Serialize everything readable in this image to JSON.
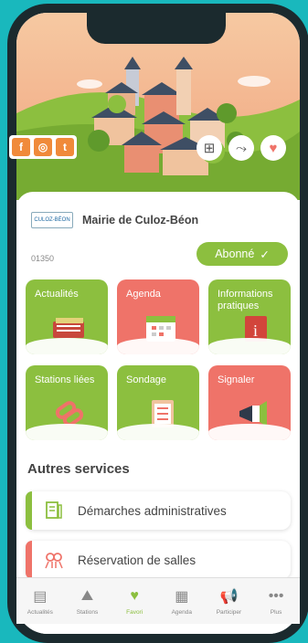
{
  "mairie": {
    "name": "Mairie de Culoz-Béon",
    "logo_text": "CULOZ-BÉON",
    "postal_code": "01350"
  },
  "subscribe_label": "Abonné",
  "social": {
    "facebook": "f",
    "instagram": "◎",
    "twitter": "t"
  },
  "tiles": [
    {
      "label": "Actualités",
      "color": "#8cbf3f"
    },
    {
      "label": "Agenda",
      "color": "#ef7369"
    },
    {
      "label": "Informations pratiques",
      "color": "#8cbf3f"
    },
    {
      "label": "Stations liées",
      "color": "#8cbf3f"
    },
    {
      "label": "Sondage",
      "color": "#8cbf3f"
    },
    {
      "label": "Signaler",
      "color": "#ef7369"
    }
  ],
  "autres_title": "Autres services",
  "services": [
    {
      "label": "Démarches administratives",
      "accent": "#8cbf3f",
      "icon": "document-icon"
    },
    {
      "label": "Réservation de salles",
      "accent": "#ef7369",
      "icon": "people-icon"
    }
  ],
  "tabbar": [
    {
      "label": "Actualités",
      "icon": "news-icon"
    },
    {
      "label": "Stations",
      "icon": "mountain-icon"
    },
    {
      "label": "Favori",
      "icon": "heart-icon",
      "active": true
    },
    {
      "label": "Agenda",
      "icon": "calendar-icon"
    },
    {
      "label": "Participer",
      "icon": "megaphone-icon"
    },
    {
      "label": "Plus",
      "icon": "more-icon"
    }
  ]
}
